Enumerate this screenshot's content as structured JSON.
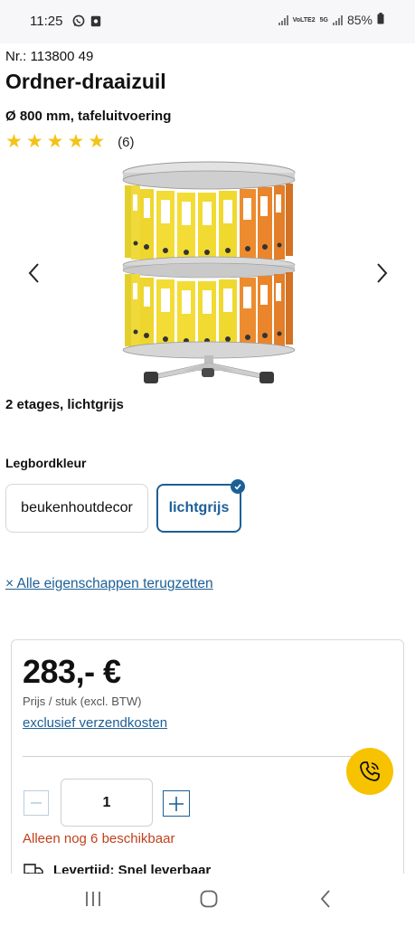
{
  "status_bar": {
    "time": "11:25",
    "battery": "85%",
    "network_volte": "VoLTE2",
    "network_5g": "5G",
    "icons": [
      "whatsapp-icon",
      "app-notification-icon",
      "signal-icon",
      "signal-icon",
      "battery-icon"
    ]
  },
  "product": {
    "article_number": "Nr.: 113800 49",
    "title": "Ordner-draaizuil",
    "subtitle": "Ø 800 mm, tafeluitvoering",
    "rating": {
      "stars": 5,
      "count_label": "(6)"
    },
    "variant_description": "2 etages, lichtgrijs",
    "image_icon": "rotating-file-carousel-image"
  },
  "gallery": {
    "prev_icon": "chevron-left-icon",
    "next_icon": "chevron-right-icon"
  },
  "color_selector": {
    "label": "Legbordkleur",
    "options": [
      {
        "label": "beukenhoutdecor",
        "selected": false
      },
      {
        "label": "lichtgrijs",
        "selected": true
      }
    ]
  },
  "reset_link": "× Alle eigenschappen terugzetten",
  "buy_box": {
    "price": "283,- €",
    "price_note": "Prijs / stuk (excl. BTW)",
    "shipping_link": "exclusief verzendkosten",
    "quantity": "1",
    "availability": "Alleen nog 6 beschikbaar",
    "delivery": "Levertijd: Snel leverbaar"
  },
  "colors": {
    "accent": "#1c5f96",
    "phone_button": "#f7c300",
    "star": "#f3c316",
    "availability": "#c0401c"
  },
  "nav": {
    "icons": [
      "recent-apps-icon",
      "home-icon",
      "back-icon"
    ]
  }
}
